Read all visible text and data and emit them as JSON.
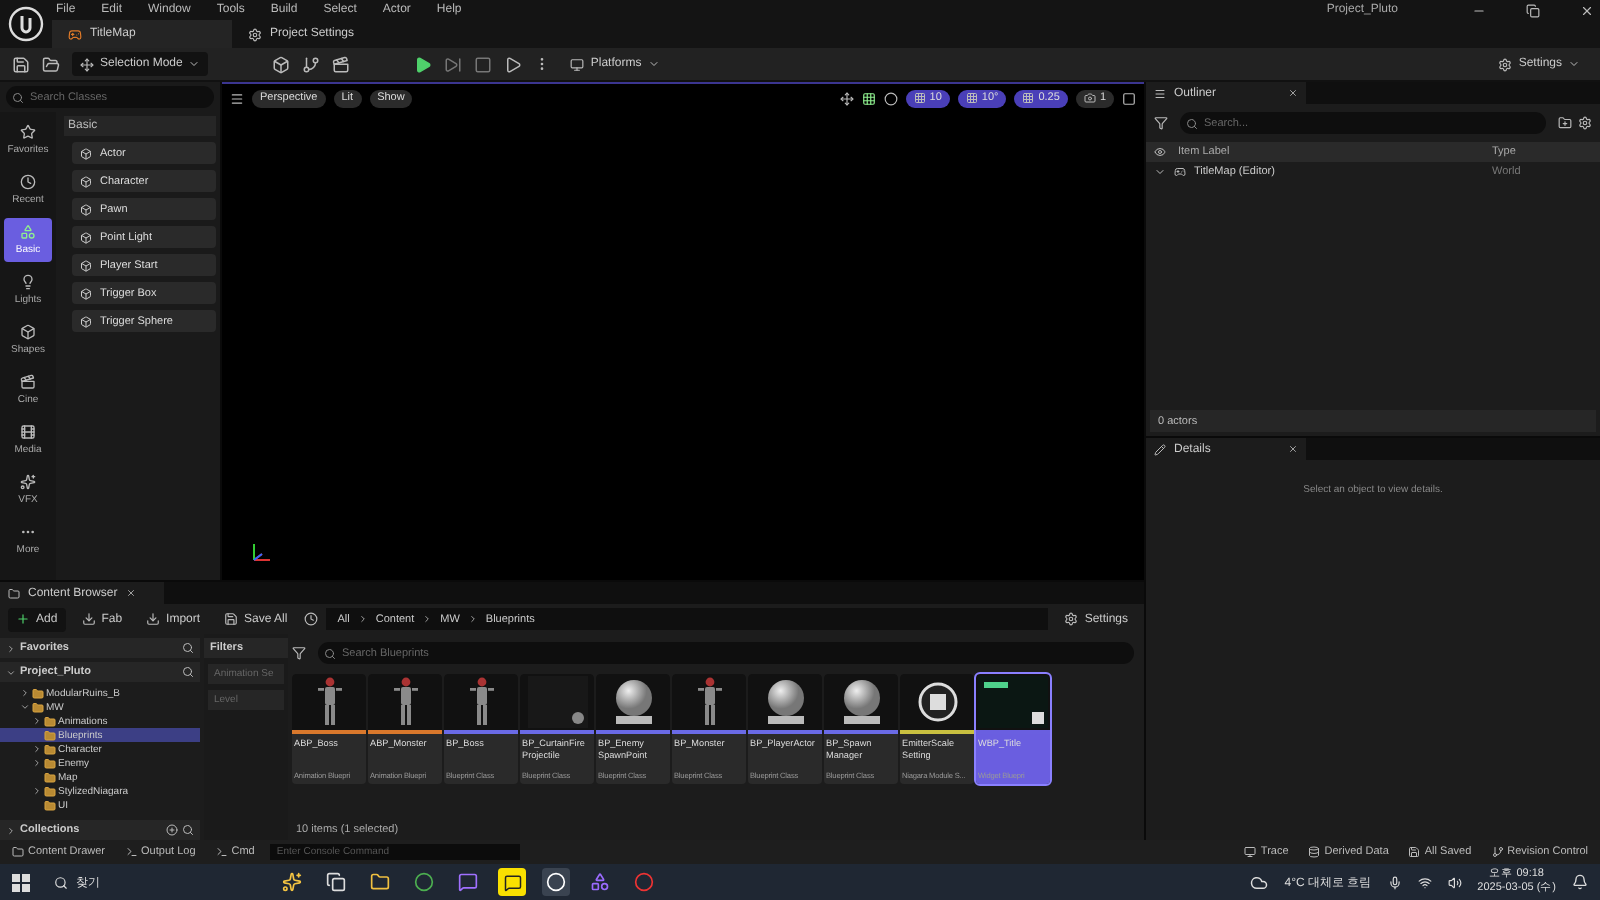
{
  "title_bar": {
    "menus": [
      "File",
      "Edit",
      "Window",
      "Tools",
      "Build",
      "Select",
      "Actor",
      "Help"
    ],
    "project": "Project_Pluto"
  },
  "tabs": [
    {
      "label": "TitleMap",
      "selected": true
    },
    {
      "label": "Project Settings",
      "selected": false
    }
  ],
  "toolbar": {
    "mode": "Selection Mode",
    "platforms": "Platforms",
    "settings": "Settings"
  },
  "place_actors": {
    "search": {
      "placeholder": "Search Classes"
    },
    "categories": [
      {
        "label": "Favorites",
        "selected": false,
        "kind": "star"
      },
      {
        "label": "Recent",
        "selected": false,
        "kind": "clock"
      },
      {
        "label": "Basic",
        "selected": true,
        "kind": "shapes"
      },
      {
        "label": "Lights",
        "selected": false,
        "kind": "bulb"
      },
      {
        "label": "Shapes",
        "selected": false,
        "kind": "cube"
      },
      {
        "label": "Cine",
        "selected": false,
        "kind": "clapper"
      },
      {
        "label": "Media",
        "selected": false,
        "kind": "media"
      },
      {
        "label": "VFX",
        "selected": false,
        "kind": "sparkle"
      },
      {
        "label": "More",
        "selected": false,
        "kind": "more"
      }
    ],
    "heading": "Basic",
    "items": [
      "Actor",
      "Character",
      "Pawn",
      "Point Light",
      "Player Start",
      "Trigger Box",
      "Trigger Sphere"
    ]
  },
  "viewport": {
    "buttons": [
      "Perspective",
      "Lit",
      "Show"
    ],
    "readouts": [
      "10",
      "10°",
      "0.25",
      "1"
    ]
  },
  "outliner": {
    "title": "Outliner",
    "search": {
      "placeholder": "Search..."
    },
    "columns": [
      "Item Label",
      "Type"
    ],
    "rows": [
      {
        "label": "TitleMap (Editor)",
        "type": "World",
        "expanded": true
      }
    ],
    "count": "0 actors"
  },
  "details": {
    "title": "Details",
    "message": "Select an object to view details."
  },
  "content_browser": {
    "title": "Content Browser",
    "actions": [
      "Add",
      "Fab",
      "Import",
      "Save All"
    ],
    "breadcrumb": [
      "All",
      "Content",
      "MW",
      "Blueprints"
    ],
    "settings": "Settings",
    "sources": {
      "favorites": "Favorites",
      "project": "Project_Pluto",
      "collections": "Collections",
      "tree": [
        {
          "label": "ModularRuins_B",
          "kind": "branch",
          "selected": false
        },
        {
          "label": "MW",
          "kind": "open",
          "selected": false,
          "children": [
            {
              "label": "Animations",
              "kind": "branch",
              "selected": false
            },
            {
              "label": "Blueprints",
              "kind": "leaf",
              "selected": true
            },
            {
              "label": "Character",
              "kind": "branch",
              "selected": false
            },
            {
              "label": "Enemy",
              "kind": "branch",
              "selected": false
            },
            {
              "label": "Map",
              "kind": "leaf",
              "selected": false
            },
            {
              "label": "StylizedNiagara",
              "kind": "branch",
              "selected": false
            },
            {
              "label": "UI",
              "kind": "leaf",
              "selected": false
            }
          ]
        }
      ]
    },
    "filters": {
      "title": "Filters",
      "chips": [
        "Animation Se",
        "Level"
      ]
    },
    "search": {
      "placeholder": "Search Blueprints"
    },
    "assets": [
      {
        "name": "ABP_Boss",
        "type": "Animation Bluepri",
        "kind": "figure",
        "color": "#d9782c",
        "selected": false
      },
      {
        "name": "ABP_Monster",
        "type": "Animation Bluepri",
        "kind": "figure",
        "color": "#d9782c",
        "selected": false
      },
      {
        "name": "BP_Boss",
        "type": "Blueprint Class",
        "kind": "figure",
        "color": "#6a6ae6",
        "selected": false
      },
      {
        "name": "BP_CurtainFire Projectile",
        "type": "Blueprint Class",
        "kind": "empty",
        "color": "#6a6ae6",
        "selected": false
      },
      {
        "name": "BP_Enemy SpawnPoint",
        "type": "Blueprint Class",
        "kind": "sphere",
        "color": "#6a6ae6",
        "selected": false
      },
      {
        "name": "BP_Monster",
        "type": "Blueprint Class",
        "kind": "figure",
        "color": "#6a6ae6",
        "selected": false
      },
      {
        "name": "BP_PlayerActor",
        "type": "Blueprint Class",
        "kind": "sphere",
        "color": "#6a6ae6",
        "selected": false
      },
      {
        "name": "BP_Spawn Manager",
        "type": "Blueprint Class",
        "kind": "sphere",
        "color": "#6a6ae6",
        "selected": false
      },
      {
        "name": "EmitterScale Setting",
        "type": "Niagara Module S...",
        "kind": "niagara",
        "color": "#c9c040",
        "selected": false
      },
      {
        "name": "WBP_Title",
        "type": "Widget Bluepri",
        "kind": "widget",
        "color": "#6a5fe0",
        "selected": true
      }
    ],
    "count": "10 items (1 selected)"
  },
  "status_bar": {
    "left": [
      "Content Drawer",
      "Output Log",
      "Cmd"
    ],
    "console": {
      "placeholder": "Enter Console Command"
    },
    "right": [
      "Trace",
      "Derived Data",
      "All Saved",
      "Revision Control"
    ]
  },
  "taskbar": {
    "search": "찾기",
    "weather": "4°C 대체로 흐림",
    "time": "오후 09:18",
    "date": "2025-03-05 (수)"
  }
}
